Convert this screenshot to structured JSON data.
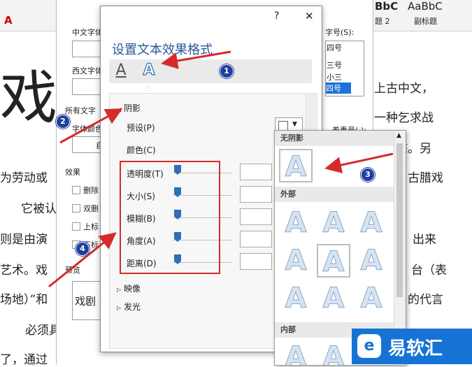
{
  "ribbon": {
    "style_samples": [
      "BbC",
      "AaBbC"
    ],
    "style_names": [
      "题 2",
      "副标题"
    ]
  },
  "doc": {
    "big_char": "戏",
    "lines_right": [
      "上古中文，",
      "一种乞求战",
      "态。另",
      "古腊戏",
      "出来",
      "台（表",
      "的代言"
    ],
    "lines_left": [
      "为劳动或",
      "它被认",
      "则是由演",
      "艺术。戏",
      "场地）”和",
      "必须具",
      "了，通过"
    ]
  },
  "font_dialog": {
    "chinese_font_label": "中文字体",
    "western_font_label": "西文字体",
    "all_text_label": "所有文字",
    "font_color_label": "字体颜色",
    "effects_label": "效果",
    "checkboxes": [
      "删除",
      "双删",
      "上标",
      "下标"
    ],
    "preview_label": "预览",
    "preview_text": "戏剧",
    "size_label": "字号(S):",
    "size_items": [
      "四号",
      "三号",
      "小三",
      "四号"
    ],
    "emphasis_label": "着重号(·):",
    "auto_label": "自"
  },
  "dialog": {
    "title": "设置文本效果格式",
    "help": "?",
    "close": "✕",
    "section_shadow": "阴影",
    "preset_label": "预设(P)",
    "color_label": "颜色(C)",
    "sliders": [
      {
        "label": "透明度(T)"
      },
      {
        "label": "大小(S)"
      },
      {
        "label": "模糊(B)"
      },
      {
        "label": "角度(A)"
      },
      {
        "label": "距离(D)"
      }
    ],
    "section_reflection": "映像",
    "section_glow": "发光"
  },
  "popup": {
    "no_shadow": "无阴影",
    "outer": "外部",
    "inner": "内部",
    "glyph": "A"
  },
  "badges": [
    "1",
    "2",
    "3",
    "4"
  ],
  "logo_text": "易软汇",
  "colors": {
    "accent": "#2b5797",
    "annotation_red": "#d52b2b",
    "badge": "#1f3f9f",
    "logo": "#1673d6"
  }
}
